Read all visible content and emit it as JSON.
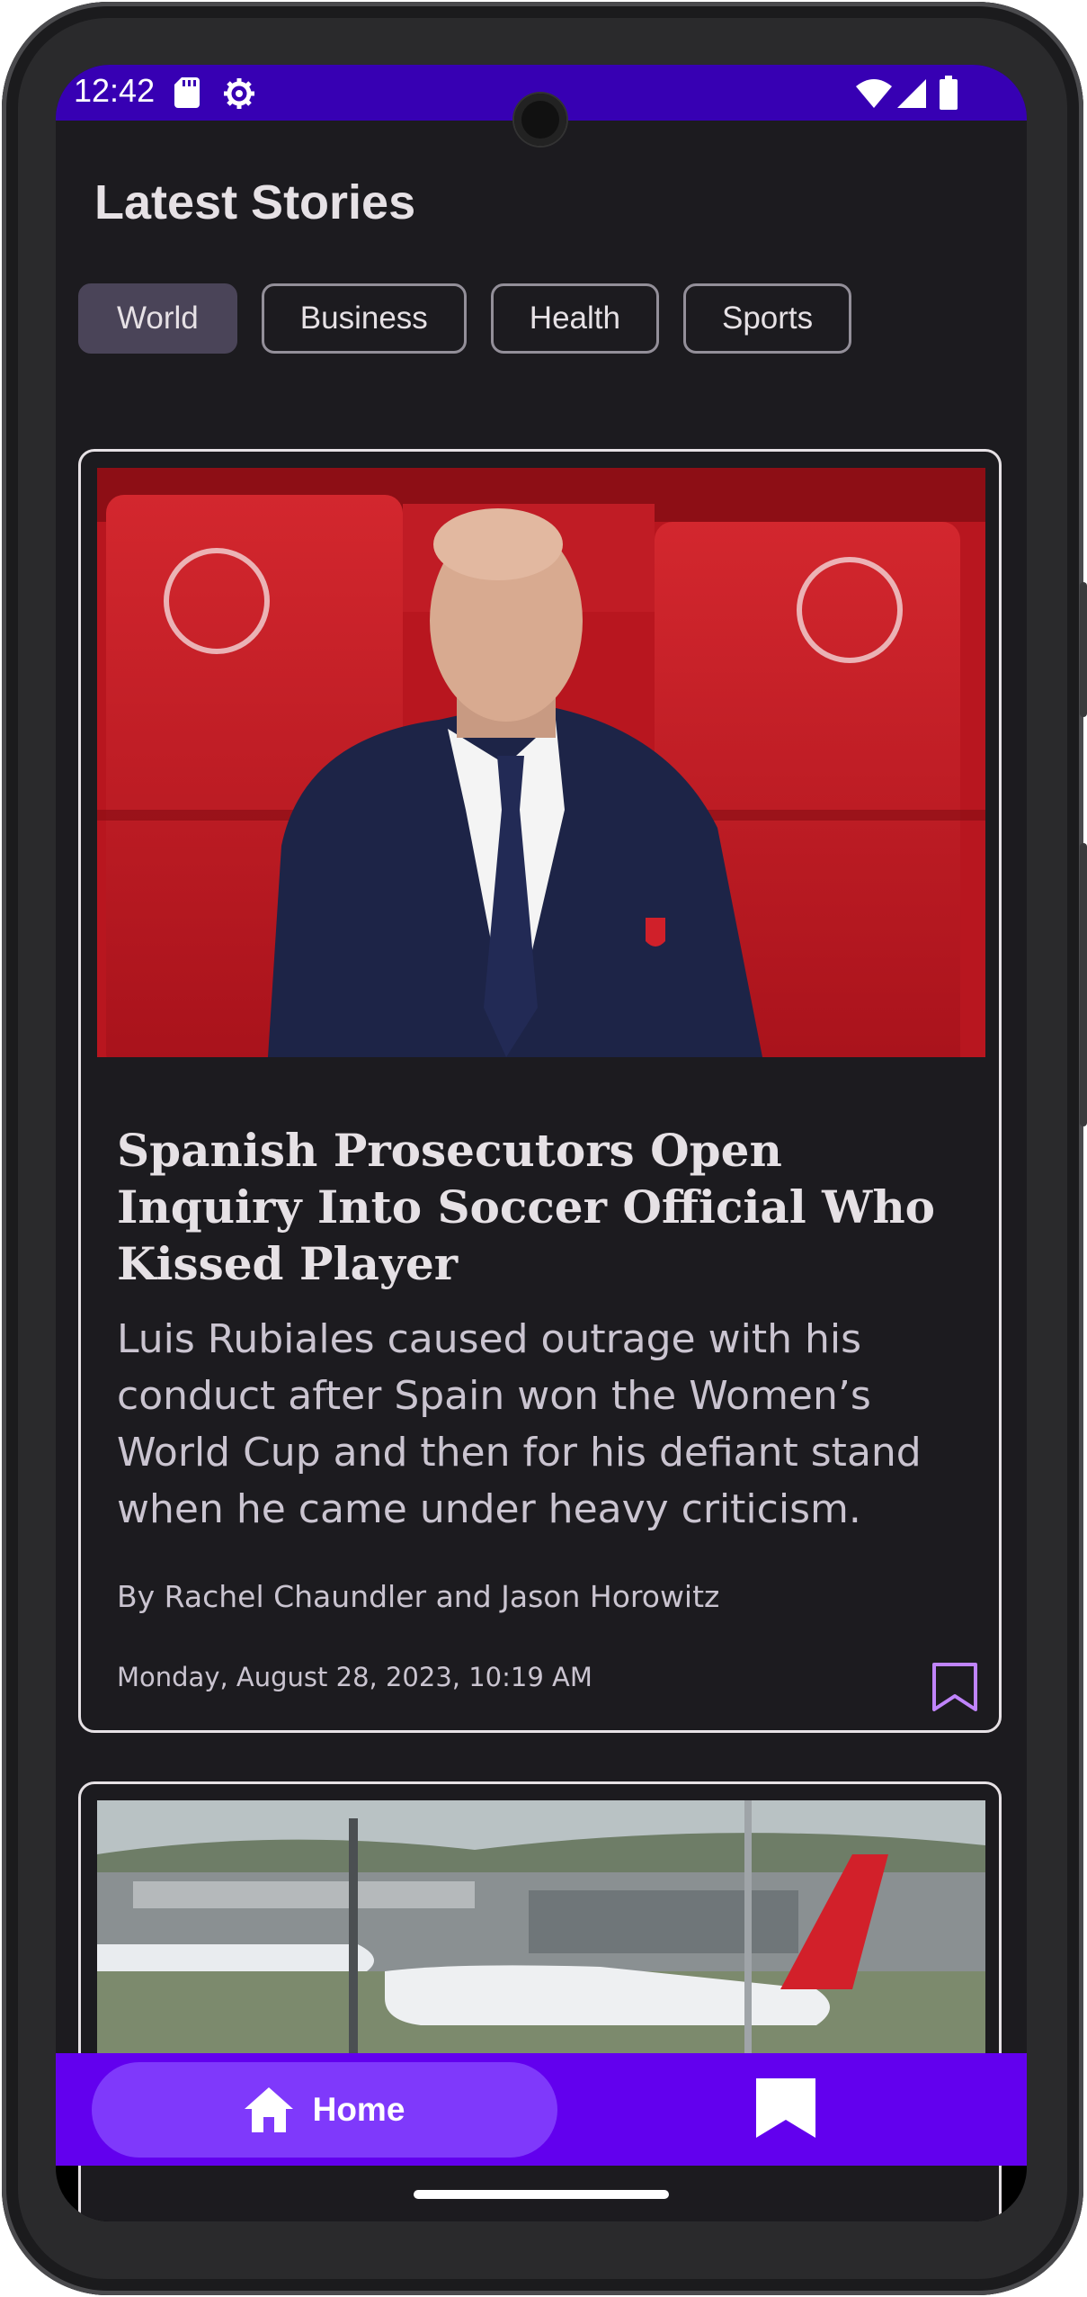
{
  "status_bar": {
    "time": "12:42",
    "left_icons": [
      "sd-card-icon",
      "settings-gear-icon"
    ],
    "right_icons": [
      "wifi-icon",
      "cellular-signal-icon",
      "battery-icon"
    ],
    "background": "#3700b3"
  },
  "header": {
    "title": "Latest Stories"
  },
  "categories": {
    "items": [
      {
        "label": "World",
        "selected": true
      },
      {
        "label": "Business",
        "selected": false
      },
      {
        "label": "Health",
        "selected": false
      },
      {
        "label": "Sports",
        "selected": false
      }
    ]
  },
  "stories": [
    {
      "image": "photo of a man in a navy suit in front of red stadium seats",
      "headline": "Spanish Prosecutors Open Inquiry Into Soccer Official Who Kissed Player",
      "summary": "Luis Rubiales caused outrage with his conduct after Spain won the Women’s World Cup and then for his defiant stand when he came under heavy criticism.",
      "byline": "By Rachel Chaundler and Jason Horowitz",
      "date": "Monday, August 28, 2023, 10:19 AM",
      "bookmark_icon": "bookmark-outline-icon"
    },
    {
      "image": "photo of airliners on an airport apron, one with QANTAS livery"
    }
  ],
  "bottom_nav": {
    "home_label": "Home",
    "home_icon": "home-icon",
    "saved_icon": "bookmark-filled-icon",
    "background": "#6200ee",
    "active_pill": "#7f39fb"
  },
  "colors": {
    "accent_bookmark": "#c084fc",
    "surface": "#1c1b1f",
    "on_surface": "#e6e1e5"
  }
}
